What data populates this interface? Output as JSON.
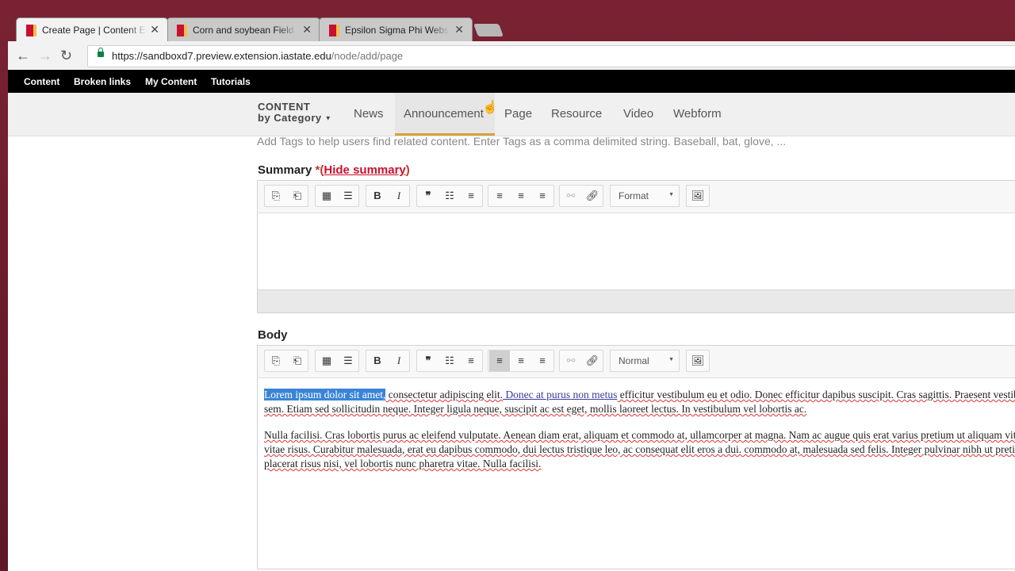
{
  "browser": {
    "tabs": [
      {
        "title": "Create Page | Content Ed"
      },
      {
        "title": "Corn and soybean Field"
      },
      {
        "title": "Epsilon Sigma Phi Websi"
      }
    ],
    "url_host": "https://sandboxd7.preview.extension.iastate.edu",
    "url_path": "/node/add/page"
  },
  "adminbar": [
    "Content",
    "Broken links",
    "My Content",
    "Tutorials"
  ],
  "subnav": {
    "cat_line1": "CONTENT",
    "cat_line2": "by Category",
    "items": [
      "News",
      "Announcement",
      "Page",
      "Resource",
      "Video",
      "Webform"
    ]
  },
  "tags_hint": "Add Tags to help users find related content. Enter Tags as a comma delimited string. Baseball, bat, glove, ...",
  "summary": {
    "label": "Summary",
    "required": "*",
    "hide_link": "Hide summary",
    "format": "Format"
  },
  "body": {
    "label": "Body",
    "format": "Normal",
    "p1_selected": "Lorem ipsum dolor sit amet,",
    "p1_a": " consectetur adipiscing elit.",
    "p1_link": " Donec at purus non metus",
    "p1_b": " efficitur vestibulum eu et odio. Donec efficitur dapibus suscipit. Cras sagittis. Praesent vestibulum luctus sem. Etiam sed sollicitudin neque. Integer ligula neque, suscipit ac est eget, mollis laoreet lectus. In vestibulum vel lobortis ac.",
    "p2": "Nulla facilisi. Cras lobortis purus ac eleifend vulputate. Aenean diam erat, aliquam et commodo at, ullamcorper at magna. Nam ac augue quis erat varius pretium ut aliquam vitae, fermentum vitae risus. Curabitur malesuada, erat eu dapibus commodo, dui lectus tristique leo, ac consequat elit eros a dui. commodo at, malesuada sed felis. Integer pulvinar nibh ut pretium luctus. Sed placerat risus nisi, vel lobortis nunc pharetra vitae. Nulla facilisi."
  },
  "colors": {
    "accent": "#d4a43a",
    "brand": "#c8102e",
    "selection": "#3a84d8"
  }
}
